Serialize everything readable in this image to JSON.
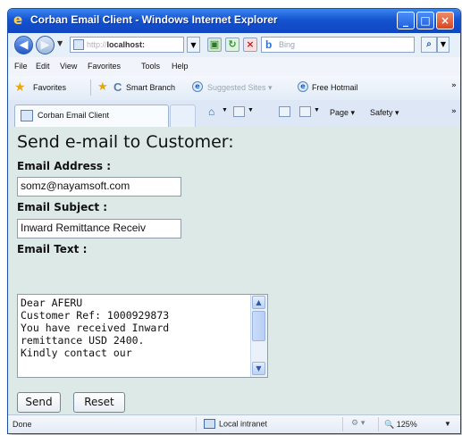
{
  "window": {
    "title": "Corban Email Client - Windows Internet Explorer",
    "controls": {
      "minimize": "_",
      "maximize": "□",
      "close": "×"
    }
  },
  "address_bar": {
    "url_prefix": "http://",
    "url_host": "localhost:",
    "search_engine": "b",
    "search_placeholder": "Bing",
    "search_button": "⌕"
  },
  "menu": {
    "items": [
      "File",
      "Edit",
      "View",
      "Favorites",
      "Tools",
      "Help"
    ]
  },
  "favorites_bar": {
    "favorites_label": "Favorites",
    "items": [
      "Smart Branch",
      "Suggested Sites ▾",
      "Free Hotmail"
    ],
    "more": "»"
  },
  "tab": {
    "label": "Corban Email Client"
  },
  "command_bar": {
    "page": "Page ▾",
    "safety": "Safety ▾",
    "more": "»"
  },
  "page": {
    "title": "Send e-mail to Customer:",
    "email_address_label": "Email Address :",
    "email_address_value": "somz@nayamsoft.com",
    "email_subject_label": "Email Subject :",
    "email_subject_value": "Inward Remittance Receiv",
    "email_text_label": "Email Text :",
    "email_text_value": "Dear AFERU\nCustomer Ref: 1000929873\nYou have received Inward\nremittance USD 2400.\nKindly contact our",
    "send_button": "Send",
    "reset_button": "Reset"
  },
  "status_bar": {
    "status": "Done",
    "zone": "Local intranet",
    "zoom": "125%"
  },
  "colors": {
    "titlebar": "#1553cf",
    "page_background": "#dde9e7",
    "accent": "#2b74dc"
  }
}
